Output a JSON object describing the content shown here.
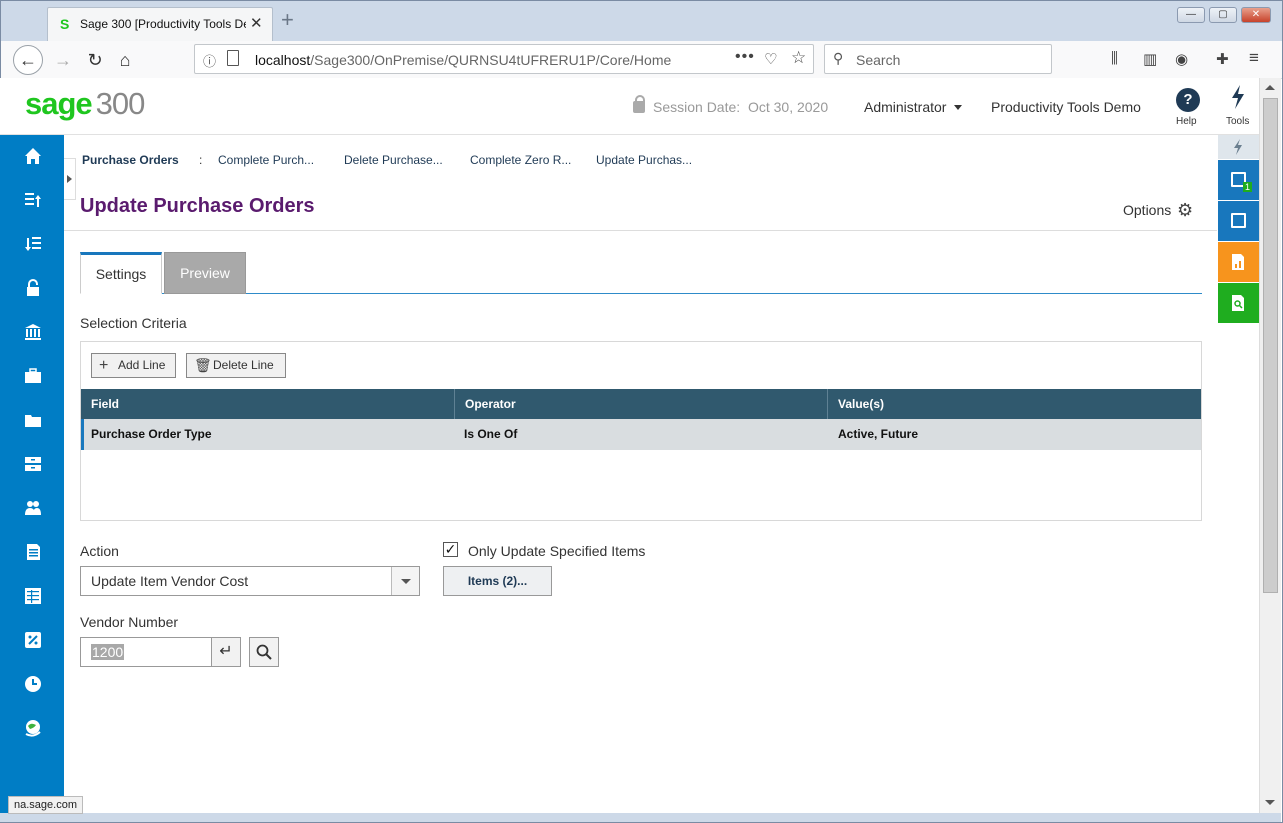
{
  "browser": {
    "tab_title": "Sage 300 [Productivity Tools De",
    "favicon_letter": "S",
    "url_host": "localhost",
    "url_path": "/Sage300/OnPremise/QURNSU4tUFRERU1P/Core/Home",
    "url_menu": "•••",
    "search_placeholder": "Search",
    "status_text": "na.sage.com",
    "icons": [
      "back-icon",
      "forward-icon",
      "reload-icon",
      "home-icon",
      "library-icon",
      "sidebar-icon",
      "account-icon",
      "gift-icon",
      "menu-icon"
    ]
  },
  "header": {
    "logo_sage": "sage",
    "logo_num": "300",
    "session_label": "Session Date:",
    "session_date": "Oct 30, 2020",
    "user": "Administrator",
    "company": "Productivity Tools Demo",
    "help_glyph": "?",
    "help_label": "Help",
    "tools_label": "Tools"
  },
  "breadcrumb": {
    "root": "Purchase Orders",
    "sep": ":",
    "items": [
      "Complete Purch...",
      "Delete Purchase...",
      "Complete Zero R...",
      "Update Purchas..."
    ]
  },
  "page": {
    "title": "Update Purchase Orders",
    "options_label": "Options"
  },
  "tabs": [
    {
      "label": "Settings",
      "active": true
    },
    {
      "label": "Preview",
      "active": false
    }
  ],
  "criteria": {
    "title": "Selection Criteria",
    "add_label": "Add Line",
    "delete_label": "Delete Line",
    "columns": [
      "Field",
      "Operator",
      "Value(s)"
    ],
    "rows": [
      {
        "field": "Purchase Order Type",
        "operator": "Is One Of",
        "values": "Active, Future"
      }
    ]
  },
  "form": {
    "action_label": "Action",
    "action_value": "Update Item Vendor Cost",
    "only_update_label": "Only Update Specified Items",
    "only_update_checked": true,
    "items_button": "Items (2)...",
    "vendor_label": "Vendor Number",
    "vendor_value": "1200"
  },
  "colors": {
    "nav_blue": "#007dc5",
    "title_purple": "#5a1b6e",
    "grid_header": "#30596e",
    "sage_green": "#1fc61f",
    "rp_blue": "#1877bd",
    "rp_orange": "#f7941d",
    "rp_green": "#1fad1f"
  }
}
